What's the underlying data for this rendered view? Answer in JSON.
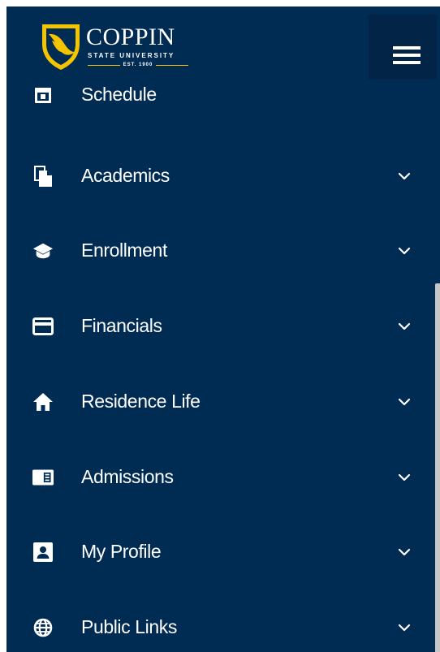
{
  "header": {
    "logo_name": "COPPIN",
    "logo_subtitle": "STATE UNIVERSITY",
    "logo_est": "EST. 1900",
    "menu_icon": "hamburger-menu-icon"
  },
  "colors": {
    "background": "#002b53",
    "toggle_background": "#022446",
    "text": "#ffffff",
    "accent_gold": "#f5c400",
    "scrollbar_thumb": "#c6c6c6"
  },
  "menu": {
    "items": [
      {
        "label": "Schedule",
        "icon": "calendar-icon",
        "expandable": false
      },
      {
        "label": "Academics",
        "icon": "documents-icon",
        "expandable": true
      },
      {
        "label": "Enrollment",
        "icon": "graduation-cap-icon",
        "expandable": true
      },
      {
        "label": "Financials",
        "icon": "credit-card-icon",
        "expandable": true
      },
      {
        "label": "Residence Life",
        "icon": "home-icon",
        "expandable": true
      },
      {
        "label": "Admissions",
        "icon": "newspaper-icon",
        "expandable": true
      },
      {
        "label": "My Profile",
        "icon": "contact-card-icon",
        "expandable": true
      },
      {
        "label": "Public Links",
        "icon": "globe-icon",
        "expandable": true
      }
    ]
  }
}
